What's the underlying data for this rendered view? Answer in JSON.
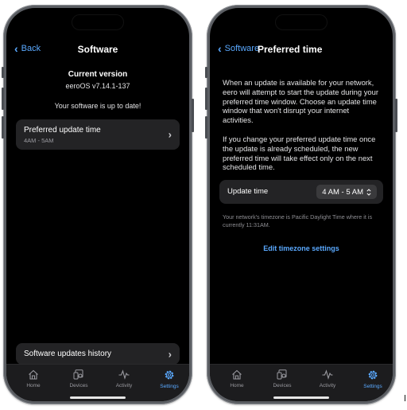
{
  "left_screen": {
    "nav": {
      "back_label": "Back",
      "title": "Software"
    },
    "version_heading": "Current version",
    "version_value": "eeroOS v7.14.1-137",
    "status_text": "Your software is up to date!",
    "preferred_update": {
      "title": "Preferred update time",
      "value": "4AM - 5AM"
    },
    "history_label": "Software updates history"
  },
  "right_screen": {
    "nav": {
      "back_label": "Software",
      "title": "Preferred time"
    },
    "paragraph_1": "When an update is available for your network, eero will attempt to start the update during your preferred time window. Choose an update time window that won't disrupt your internet activities.",
    "paragraph_2": "If you change your preferred update time once the update is already scheduled, the new preferred time will take effect only on the next scheduled time.",
    "update_time": {
      "label": "Update time",
      "value": "4 AM - 5 AM"
    },
    "timezone_note": "Your network's timezone is Pacific Daylight Time where it is currently 11:31AM.",
    "timezone_link": "Edit timezone settings"
  },
  "tabbar": {
    "tabs": [
      {
        "label": "Home",
        "icon": "home-icon"
      },
      {
        "label": "Devices",
        "icon": "devices-icon"
      },
      {
        "label": "Activity",
        "icon": "activity-icon"
      },
      {
        "label": "Settings",
        "icon": "settings-icon"
      }
    ],
    "active": "Settings"
  },
  "colors": {
    "accent": "#5aa9ff",
    "screen_bg": "#000000",
    "card_bg": "#232325",
    "phone_frame": "#5b5e63"
  }
}
